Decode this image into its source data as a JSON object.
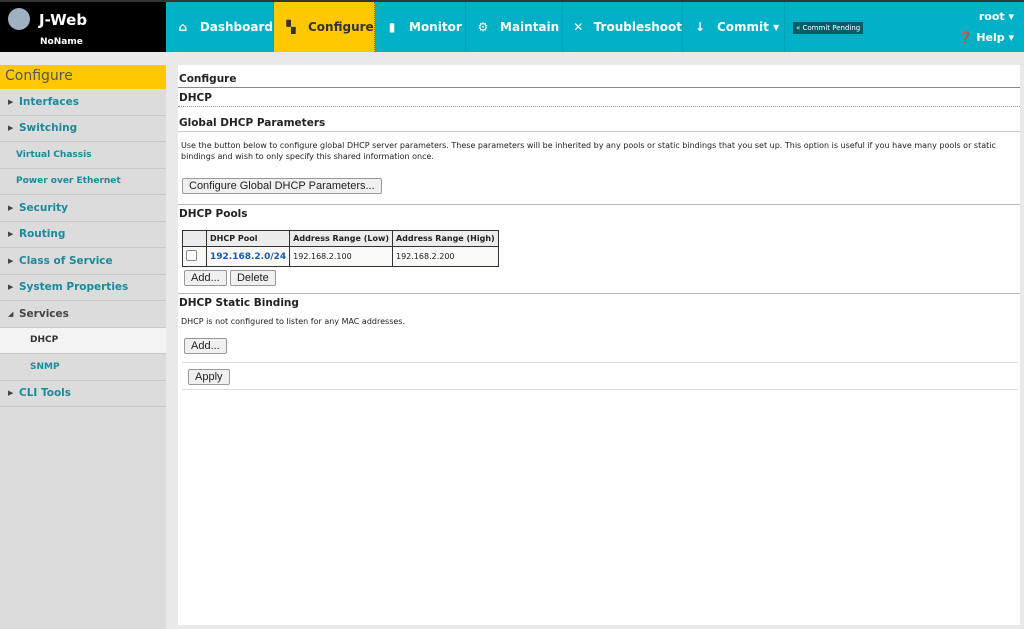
{
  "app": {
    "title": "J-Web",
    "device": "NoName"
  },
  "nav": [
    {
      "label": "Dashboard",
      "icon": "home-icon",
      "glyph": "⌂"
    },
    {
      "label": "Configure",
      "icon": "network-icon",
      "glyph": "▚"
    },
    {
      "label": "Monitor",
      "icon": "bar-chart-icon",
      "glyph": "▮"
    },
    {
      "label": "Maintain",
      "icon": "gear-icon",
      "glyph": "⚙"
    },
    {
      "label": "Troubleshoot",
      "icon": "tools-icon",
      "glyph": "✕"
    },
    {
      "label": "Commit ▾",
      "icon": "arrow-down-icon",
      "glyph": "↓"
    }
  ],
  "commit_pending": "« Commit Pending",
  "user": "root ▾",
  "help": "Help ▾",
  "sidebar": {
    "header": "Configure",
    "items": [
      {
        "label": "Interfaces",
        "arrow": "▶"
      },
      {
        "label": "Switching",
        "arrow": "▶"
      },
      {
        "label": "Virtual Chassis"
      },
      {
        "label": "Power over Ethernet"
      },
      {
        "label": "Security",
        "arrow": "▶"
      },
      {
        "label": "Routing",
        "arrow": "▶"
      },
      {
        "label": "Class of Service",
        "arrow": "▶"
      },
      {
        "label": "System Properties",
        "arrow": "▶"
      },
      {
        "label": "Services",
        "arrow": "◢"
      },
      {
        "label": "DHCP"
      },
      {
        "label": "SNMP"
      },
      {
        "label": "CLI Tools",
        "arrow": "▶"
      }
    ]
  },
  "main": {
    "breadcrumb": "Configure",
    "page": "DHCP",
    "global": {
      "title": "Global DHCP Parameters",
      "desc": "Use the button below to configure global DHCP server parameters. These parameters will be inherited by any pools or static bindings that you set up. This option is useful if you have many pools or static bindings and wish to only specify this shared information once.",
      "button": "Configure Global DHCP Parameters..."
    },
    "pools": {
      "title": "DHCP Pools",
      "columns": [
        "DHCP Pool",
        "Address Range (Low)",
        "Address Range (High)"
      ],
      "rows": [
        [
          "192.168.2.0/24",
          "192.168.2.100",
          "192.168.2.200"
        ]
      ],
      "add": "Add...",
      "delete": "Delete"
    },
    "static": {
      "title": "DHCP Static Binding",
      "desc": "DHCP is not configured to listen for any MAC addresses.",
      "add": "Add..."
    },
    "apply": "Apply"
  }
}
